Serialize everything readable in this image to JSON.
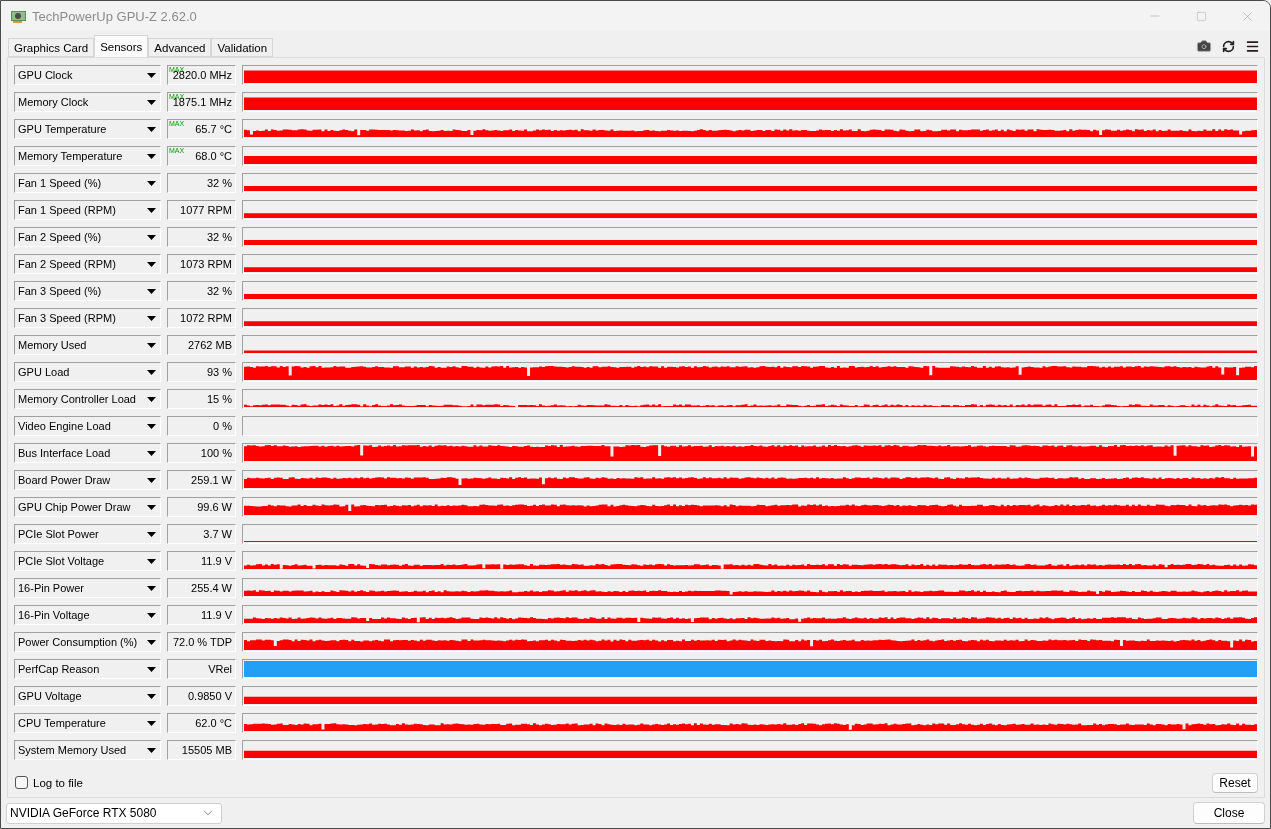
{
  "window": {
    "title": "TechPowerUp GPU-Z 2.62.0"
  },
  "tabs": [
    {
      "label": "Graphics Card",
      "selected": false
    },
    {
      "label": "Sensors",
      "selected": true
    },
    {
      "label": "Advanced",
      "selected": false
    },
    {
      "label": "Validation",
      "selected": false
    }
  ],
  "sensors": [
    {
      "name": "GPU Clock",
      "badge": "MAX",
      "value": "2820.0 MHz",
      "kind": "steady",
      "color": "#ff0000"
    },
    {
      "name": "Memory Clock",
      "badge": "MAX",
      "value": "1875.1 MHz",
      "kind": "steady",
      "color": "#ff0000"
    },
    {
      "name": "GPU Temperature",
      "badge": "MAX",
      "value": "65.7 °C",
      "kind": "noisy",
      "color": "#ff0000"
    },
    {
      "name": "Memory Temperature",
      "badge": "MAX",
      "value": "68.0 °C",
      "kind": "steady",
      "color": "#ff0000"
    },
    {
      "name": "Fan 1 Speed (%)",
      "value": "32 %",
      "kind": "steady",
      "color": "#ff0000"
    },
    {
      "name": "Fan 1 Speed (RPM)",
      "value": "1077 RPM",
      "kind": "steady",
      "color": "#ff0000"
    },
    {
      "name": "Fan 2 Speed (%)",
      "value": "32 %",
      "kind": "steady",
      "color": "#ff0000"
    },
    {
      "name": "Fan 2 Speed (RPM)",
      "value": "1073 RPM",
      "kind": "steady",
      "color": "#ff0000"
    },
    {
      "name": "Fan 3 Speed (%)",
      "value": "32 %",
      "kind": "steady",
      "color": "#ff0000"
    },
    {
      "name": "Fan 3 Speed (RPM)",
      "value": "1072 RPM",
      "kind": "steady",
      "color": "#ff0000"
    },
    {
      "name": "Memory Used",
      "value": "2762 MB",
      "kind": "steady",
      "color": "#ff0000"
    },
    {
      "name": "GPU Load",
      "value": "93 %",
      "kind": "noisy",
      "color": "#ff0000"
    },
    {
      "name": "Memory Controller Load",
      "value": "15 %",
      "kind": "noisy",
      "color": "#ff0000"
    },
    {
      "name": "Video Engine Load",
      "value": "0 %",
      "kind": "empty"
    },
    {
      "name": "Bus Interface Load",
      "value": "100 %",
      "kind": "noisy",
      "color": "#ff0000"
    },
    {
      "name": "Board Power Draw",
      "value": "259.1 W",
      "kind": "noisy",
      "color": "#ff0000"
    },
    {
      "name": "GPU Chip Power Draw",
      "value": "99.6 W",
      "kind": "noisy",
      "color": "#ff0000"
    },
    {
      "name": "PCIe Slot Power",
      "value": "3.7 W",
      "kind": "steady",
      "color": "#ff0000"
    },
    {
      "name": "PCIe Slot Voltage",
      "value": "11.9 V",
      "kind": "noisy",
      "color": "#ff0000"
    },
    {
      "name": "16-Pin Power",
      "value": "255.4 W",
      "kind": "noisy",
      "color": "#ff0000"
    },
    {
      "name": "16-Pin Voltage",
      "value": "11.9 V",
      "kind": "noisy",
      "color": "#ff0000"
    },
    {
      "name": "Power Consumption (%)",
      "value": "72.0 % TDP",
      "kind": "noisy",
      "color": "#ff0000"
    },
    {
      "name": "PerfCap Reason",
      "value": "VRel",
      "kind": "steady",
      "color": "#22a0f6"
    },
    {
      "name": "GPU Voltage",
      "value": "0.9850 V",
      "kind": "steady",
      "color": "#ff0000"
    },
    {
      "name": "CPU Temperature",
      "value": "62.0 °C",
      "kind": "noisy",
      "color": "#ff0000"
    },
    {
      "name": "System Memory Used",
      "value": "15505 MB",
      "kind": "steady",
      "color": "#ff0000"
    }
  ],
  "log_to_file": {
    "label": "Log to file",
    "checked": false
  },
  "reset_button": "Reset",
  "gpu_selector": {
    "value": "NVIDIA GeForce RTX 5080"
  },
  "close_button": "Close"
}
